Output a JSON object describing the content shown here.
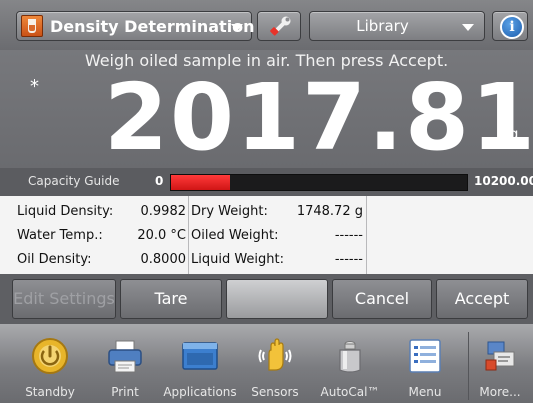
{
  "header": {
    "app_title": "Density Determination",
    "app_icon": "density-icon",
    "settings_icon": "wrench-icon",
    "library_label": "Library",
    "info_icon": "info-icon",
    "info_glyph": "i"
  },
  "prompt": "Weigh oiled sample in air. Then press Accept.",
  "reading": {
    "stability_marker": "*",
    "value": "2017.81",
    "unit": "g"
  },
  "capacity_guide": {
    "label": "Capacity Guide",
    "min": "0",
    "max": "10200.00",
    "fill_fraction": 0.198,
    "fill_color": "#e02020"
  },
  "info": {
    "liquid_density_label": "Liquid Density:",
    "liquid_density_value": "0.9982",
    "water_temp_label": "Water Temp.:",
    "water_temp_value": "20.0 °C",
    "oil_density_label": "Oil Density:",
    "oil_density_value": "0.8000",
    "dry_weight_label": "Dry Weight:",
    "dry_weight_value": "1748.72 g",
    "oiled_weight_label": "Oiled Weight:",
    "oiled_weight_value": "------",
    "liquid_weight_label": "Liquid Weight:",
    "liquid_weight_value": "------"
  },
  "actions": {
    "edit_settings": "Edit Settings",
    "tare": "Tare",
    "cancel": "Cancel",
    "accept": "Accept"
  },
  "dock": {
    "standby": "Standby",
    "print": "Print",
    "applications": "Applications",
    "sensors": "Sensors",
    "autocal": "AutoCal™",
    "menu": "Menu",
    "more": "More..."
  }
}
